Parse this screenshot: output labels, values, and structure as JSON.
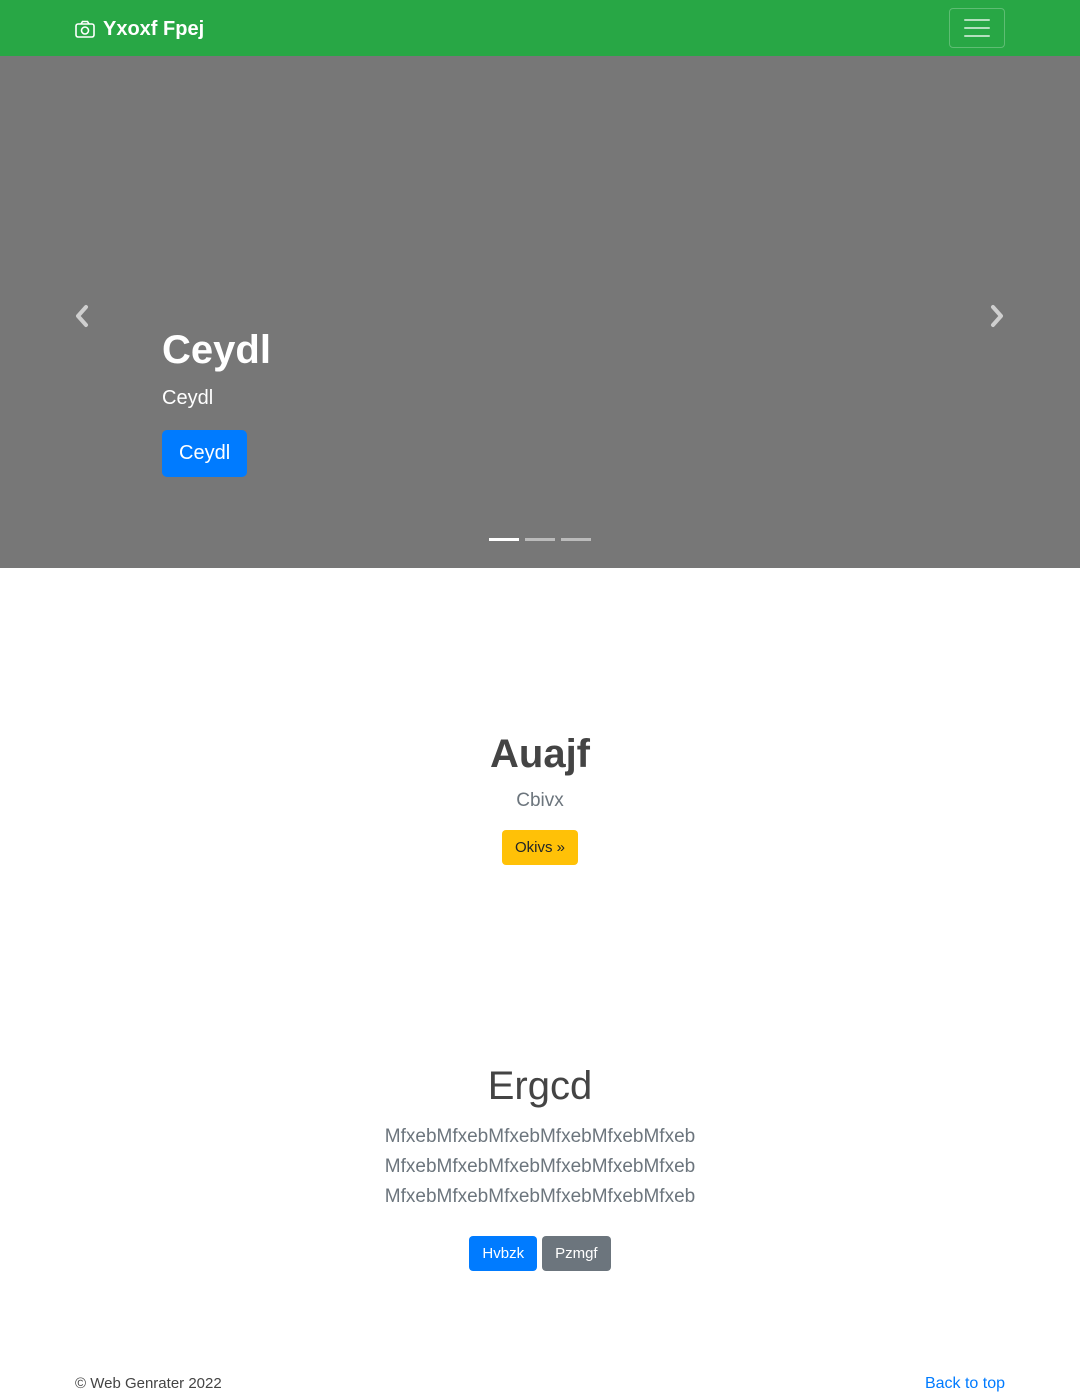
{
  "navbar": {
    "brand": "Yxoxf Fpej",
    "brand_icon": "camera-icon",
    "toggler_icon": "hamburger-menu-icon",
    "background": "#28a745"
  },
  "carousel": {
    "title": "Ceydl",
    "subtitle": "Ceydl",
    "button_label": "Ceydl",
    "prev_icon": "chevron-left-icon",
    "next_icon": "chevron-right-icon",
    "slide_count": 3,
    "active_slide": 1,
    "background": "#777777"
  },
  "jumbotron": {
    "heading": "Auajf",
    "lead": "Cbivx",
    "button_label": "Okivs »"
  },
  "section": {
    "heading": "Ergcd",
    "lines": [
      "MfxebMfxebMfxebMfxebMfxebMfxeb",
      "MfxebMfxebMfxebMfxebMfxebMfxeb",
      "MfxebMfxebMfxebMfxebMfxebMfxeb"
    ],
    "primary_button": "Hvbzk",
    "secondary_button": "Pzmgf"
  },
  "footer": {
    "copyright": "© Web Genrater 2022",
    "back_to_top": "Back to top"
  }
}
